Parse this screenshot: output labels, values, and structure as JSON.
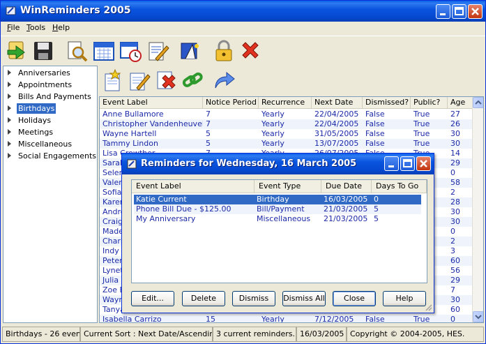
{
  "window": {
    "title": "WinReminders 2005"
  },
  "menu": [
    {
      "label": "File",
      "key": "F"
    },
    {
      "label": "Tools",
      "key": "T"
    },
    {
      "label": "Help",
      "key": "H"
    }
  ],
  "toolbar_icons": [
    "go-arrow-icon",
    "save-floppy-icon",
    "print-preview-icon",
    "calendar-icon",
    "calendar-clock-icon",
    "notepad-edit-icon",
    "wizard-icon",
    "lock-icon",
    "exit-x-icon"
  ],
  "tree": {
    "items": [
      {
        "label": "Anniversaries",
        "selected": false
      },
      {
        "label": "Appointments",
        "selected": false
      },
      {
        "label": "Bills And Payments",
        "selected": false
      },
      {
        "label": "Birthdays",
        "selected": true
      },
      {
        "label": "Holidays",
        "selected": false
      },
      {
        "label": "Meetings",
        "selected": false
      },
      {
        "label": "Miscellaneous",
        "selected": false
      },
      {
        "label": "Social Engagements",
        "selected": false
      }
    ]
  },
  "grid": {
    "columns": [
      "Event Label",
      "Notice Period",
      "Recurrence",
      "Next Date",
      "Dismissed?",
      "Public?",
      "Age"
    ],
    "rows": [
      [
        "Anne Bullamore",
        "7",
        "Yearly",
        "22/04/2005",
        "False",
        "True",
        "27"
      ],
      [
        "Christopher Vandenheuvel",
        "7",
        "Yearly",
        "22/04/2005",
        "False",
        "True",
        "26"
      ],
      [
        "Wayne Hartell",
        "5",
        "Yearly",
        "31/05/2005",
        "False",
        "True",
        "30"
      ],
      [
        "Tammy Lindon",
        "5",
        "Yearly",
        "13/07/2005",
        "False",
        "True",
        "30"
      ],
      [
        "Lisa Crowther",
        "7",
        "Yearly",
        "26/07/2005",
        "False",
        "True",
        "14"
      ],
      [
        "Sarah",
        "",
        "",
        "",
        "",
        "",
        "29"
      ],
      [
        "Selene",
        "",
        "",
        "",
        "",
        "",
        "0"
      ],
      [
        "Valerie",
        "",
        "",
        "",
        "",
        "",
        "58"
      ],
      [
        "Sofia C",
        "",
        "",
        "",
        "",
        "",
        "2"
      ],
      [
        "Karen",
        "",
        "",
        "",
        "",
        "",
        "28"
      ],
      [
        "Andre",
        "",
        "",
        "",
        "",
        "",
        "30"
      ],
      [
        "Craig",
        "",
        "",
        "",
        "",
        "",
        "30"
      ],
      [
        "Madeli",
        "",
        "",
        "",
        "",
        "",
        "0"
      ],
      [
        "Charlo",
        "",
        "",
        "",
        "",
        "",
        "2"
      ],
      [
        "Indy C",
        "",
        "",
        "",
        "",
        "",
        "3"
      ],
      [
        "Peter",
        "",
        "",
        "",
        "",
        "",
        "60"
      ],
      [
        "Lynett",
        "",
        "",
        "",
        "",
        "",
        "56"
      ],
      [
        "Julia K",
        "",
        "",
        "",
        "",
        "",
        "29"
      ],
      [
        "Zoe Bu",
        "",
        "",
        "",
        "",
        "",
        "7"
      ],
      [
        "Wayne",
        "",
        "",
        "",
        "",
        "",
        "30"
      ],
      [
        "Tanya",
        "",
        "",
        "",
        "",
        "",
        "60"
      ],
      [
        "Isabella Carrizo",
        "15",
        "Yearly",
        "7/12/2005",
        "False",
        "True",
        "0"
      ]
    ]
  },
  "status": {
    "category": "Birthdays - 26 events.",
    "sort": "Current Sort : Next Date/Ascending",
    "reminders": "3 current reminders.",
    "date": "16/03/2005",
    "copyright": "Copyright © 2004-2005, HES."
  },
  "dialog": {
    "title": "Reminders for Wednesday, 16 March 2005",
    "columns": [
      "Event Label",
      "Event Type",
      "Due Date",
      "Days To Go"
    ],
    "rows": [
      [
        "Katie Current",
        "Birthday",
        "16/03/2005",
        "0"
      ],
      [
        "Phone Bill Due - $125.00",
        "Bill/Payment",
        "21/03/2005",
        "5"
      ],
      [
        "My Anniversary",
        "Miscellaneous",
        "21/03/2005",
        "5"
      ]
    ],
    "buttons": {
      "edit": "Edit...",
      "delete": "Delete",
      "dismiss": "Dismiss",
      "dismiss_all": "Dismiss All",
      "close": "Close",
      "help": "Help"
    }
  },
  "colors": {
    "accent": "#316AC5",
    "row_text": "#1C2AA8",
    "titlebar": "#0A55DE"
  }
}
